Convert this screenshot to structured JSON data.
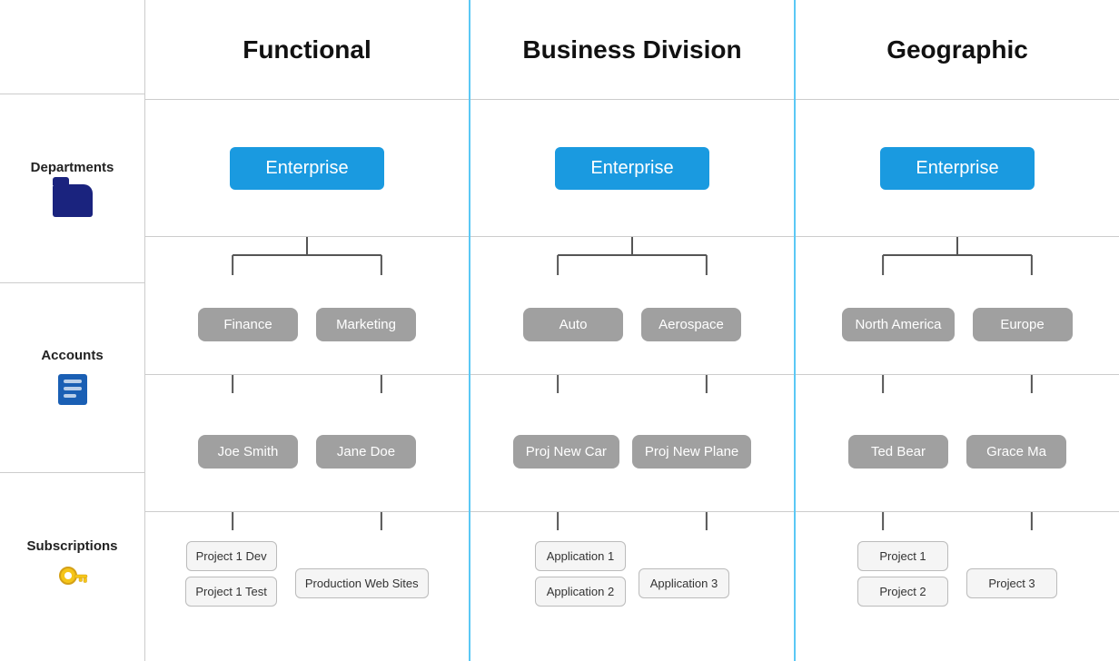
{
  "columns": {
    "functional": {
      "title": "Functional",
      "enterprise": "Enterprise",
      "departments": [
        "Finance",
        "Marketing"
      ],
      "accounts": [
        "Joe Smith",
        "Jane Doe"
      ],
      "subscriptions_left": [
        "Project 1 Dev",
        "Project 1 Test"
      ],
      "subscriptions_right": [
        "Production Web Sites"
      ]
    },
    "businessDivision": {
      "title": "Business Division",
      "enterprise": "Enterprise",
      "departments": [
        "Auto",
        "Aerospace"
      ],
      "accounts": [
        "Proj New Car",
        "Proj New Plane"
      ],
      "subscriptions_left": [
        "Application 1",
        "Application 2"
      ],
      "subscriptions_right": [
        "Application 3"
      ]
    },
    "geographic": {
      "title": "Geographic",
      "enterprise": "Enterprise",
      "departments": [
        "North America",
        "Europe"
      ],
      "accounts": [
        "Ted Bear",
        "Grace Ma"
      ],
      "subscriptions_left": [
        "Project 1",
        "Project 2"
      ],
      "subscriptions_right": [
        "Project 3"
      ]
    }
  },
  "labels": {
    "departments": "Departments",
    "accounts": "Accounts",
    "subscriptions": "Subscriptions"
  },
  "colors": {
    "blue_node": "#1a9ae0",
    "gray_node": "#9e9e9e",
    "light_node_bg": "#f5f5f5",
    "connector": "#555",
    "section_border": "#5bc8f5",
    "folder_icon": "#1a237e",
    "key_icon": "#f5c518",
    "accounts_icon": "#1a5fb4"
  }
}
